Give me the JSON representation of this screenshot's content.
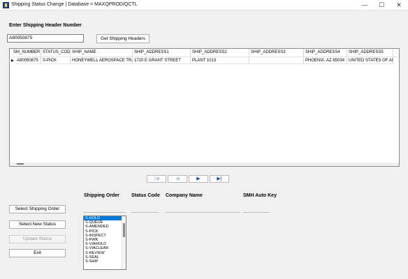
{
  "window": {
    "title": "Shipping Status Change | Database = MAXQPROD/QCTL",
    "minimize_glyph": "—",
    "maximize_glyph": "☐",
    "close_glyph": "✕"
  },
  "header_section": {
    "label": "Enter Shipping Header Number",
    "input_value": "A80050875",
    "get_button_label": "Get Shipping Headers"
  },
  "grid": {
    "columns": [
      "SM_NUMBER",
      "STATUS_CODE",
      "SHIP_NAME",
      "SHIP_ADDRESS1",
      "SHIP_ADDRESS2",
      "SHIP_ADDRESS3",
      "SHIP_ADDRESS4",
      "SHIP_ADDRESS5"
    ],
    "rows": [
      [
        "A80050875",
        "S-PICK",
        "HONEYWELL AEROSPACE TRADIN",
        "1720 E GRANT STREET",
        "PLANT 1013",
        "",
        "PHOENIX, AZ 85034",
        "UNITED STATES OF AMERICA"
      ]
    ],
    "current_row_glyph": "▶"
  },
  "navigator": {
    "first_glyph": "|◀",
    "prev_glyph": "◀",
    "next_glyph": "▶",
    "last_glyph": "▶|"
  },
  "fields": {
    "shipping_order_label": "Shipping Order",
    "status_code_label": "Status Code",
    "company_name_label": "Company Name",
    "smh_auto_key_label": "SMH Auto Key"
  },
  "buttons": {
    "select_shipping_order": "Select Shipping Order",
    "select_new_status": "Select New Status",
    "update_status": "Update Status",
    "exit": "Exit"
  },
  "status_list": {
    "items": [
      "S-HOLD",
      "S-QUEUE",
      "S-AMENDED",
      "S-PICK",
      "S-INSPECT",
      "S-PWK",
      "S-VIAHOLD",
      "S-VIACLEAR",
      "S-REVIEW",
      "S-SEAL",
      "S-SHIP"
    ],
    "selected": "S-HOLD"
  },
  "colors": {
    "selection": "#0078d7",
    "nav_enabled": "#1a4f9c"
  }
}
